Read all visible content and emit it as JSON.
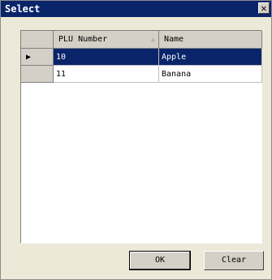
{
  "window": {
    "title": "Select",
    "close_glyph": "✕"
  },
  "grid": {
    "columns": [
      "PLU Number",
      "Name"
    ],
    "sorted_column": "PLU Number",
    "sort_glyph": "▲",
    "current_row_glyph": "▶",
    "rows": [
      {
        "plu": "10",
        "name": "Apple",
        "selected": true
      },
      {
        "plu": "11",
        "name": "Banana",
        "selected": false
      }
    ]
  },
  "buttons": {
    "ok_label": "OK",
    "clear_label": "Clear"
  },
  "colors": {
    "title_bar": "#0a246a",
    "selection": "#0a246a",
    "face": "#d4d0c8"
  }
}
